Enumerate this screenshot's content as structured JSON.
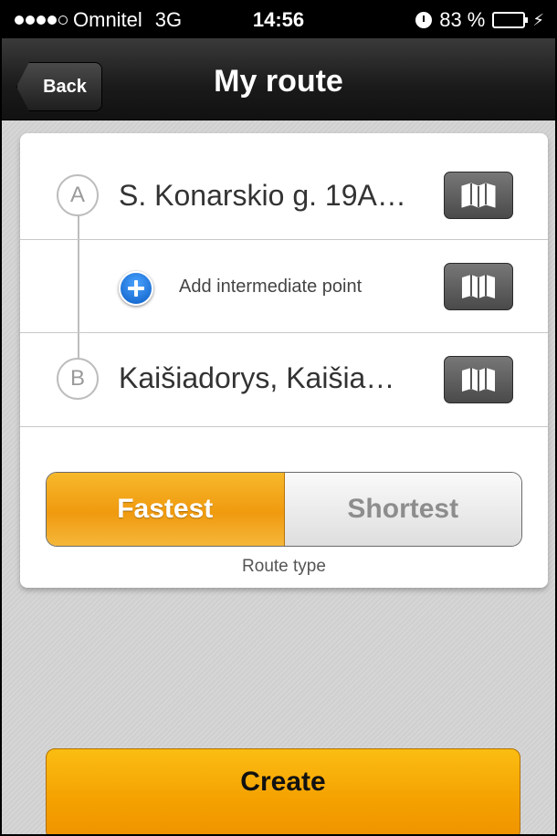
{
  "status_bar": {
    "carrier": "Omnitel",
    "network": "3G",
    "time": "14:56",
    "battery": "83 %",
    "battery_level": 0.83,
    "icons": [
      "signal-dots",
      "alarm-icon",
      "battery-icon",
      "charging-bolt-icon"
    ]
  },
  "nav": {
    "back_label": "Back",
    "title": "My route"
  },
  "route": {
    "point_a": {
      "marker": "A",
      "address": "S. Konarskio g. 19A…"
    },
    "intermediate": {
      "label": "Add intermediate point"
    },
    "point_b": {
      "marker": "B",
      "address": "Kaišiadorys, Kaišia…"
    },
    "map_icon": "map-icon"
  },
  "route_type": {
    "options": [
      "Fastest",
      "Shortest"
    ],
    "selected": "Fastest",
    "caption": "Route type"
  },
  "actions": {
    "create_label": "Create"
  },
  "colors": {
    "accent_orange": "#f4a000",
    "plus_blue": "#0b5cc4"
  }
}
